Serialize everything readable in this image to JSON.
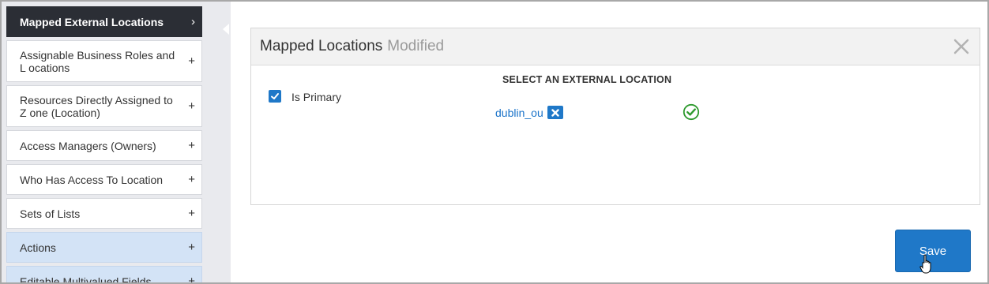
{
  "sidebar": {
    "items": [
      {
        "label": "Mapped External Locations",
        "sign": "›"
      },
      {
        "label": "Assignable Business Roles and L ocations",
        "sign": "+"
      },
      {
        "label": "Resources Directly Assigned to Z one (Location)",
        "sign": "+"
      },
      {
        "label": "Access Managers (Owners)",
        "sign": "+"
      },
      {
        "label": "Who Has Access To Location",
        "sign": "+"
      },
      {
        "label": "Sets of Lists",
        "sign": "+"
      },
      {
        "label": "Actions",
        "sign": "+"
      },
      {
        "label": "Editable Multivalued Fields",
        "sign": "+"
      }
    ]
  },
  "panel": {
    "title": "Mapped Locations",
    "status": "Modified",
    "section_title": "SELECT AN EXTERNAL LOCATION",
    "is_primary_label": "Is Primary",
    "is_primary_checked": true,
    "location_value": "dublin_ou"
  },
  "actions": {
    "save_label": "Save"
  },
  "colors": {
    "accent": "#1f78c8",
    "active_nav": "#2b2e35",
    "highlight_nav": "#d3e3f6",
    "success": "#2e9a2e"
  },
  "icons": {
    "close": "close-icon",
    "remove": "remove-tag-icon",
    "valid": "check-circle-icon",
    "pointer": "hand-pointer-icon"
  }
}
